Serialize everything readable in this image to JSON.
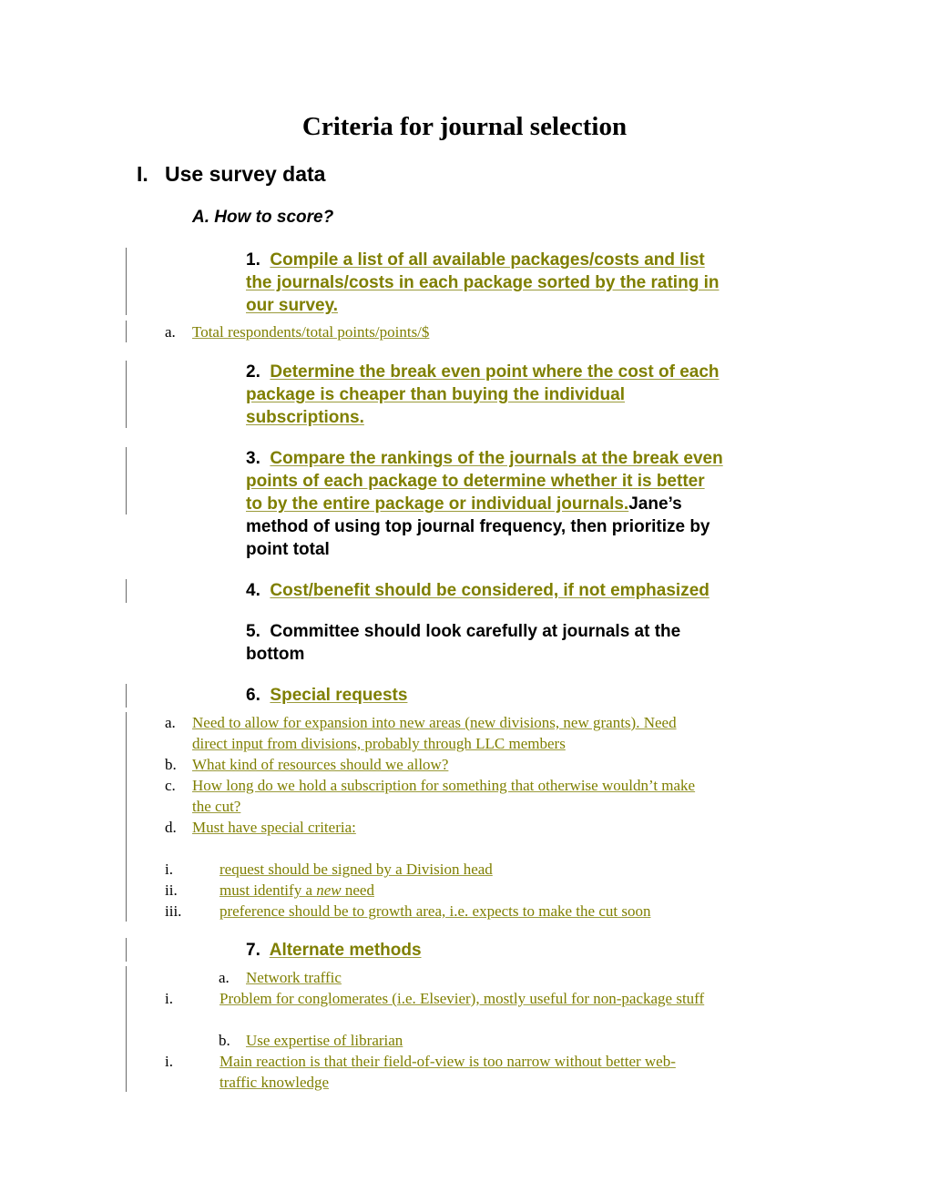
{
  "document": {
    "title": "Criteria for journal selection",
    "section": {
      "number": "I.",
      "label": "Use survey data"
    },
    "subsection": {
      "label": "A. How to score?"
    },
    "colors": {
      "revision_text": "#7f7f00",
      "revision_underline": "#9b9b3c",
      "change_bar": "#6a6a6a",
      "body_text": "#000000"
    },
    "items": [
      {
        "number": "1.",
        "lines": [
          "Compile a list of all available packages/costs and list ",
          "the journals/costs in each package sorted by the rating in ",
          "our survey."
        ],
        "sub": [
          {
            "label": "a.",
            "lines": [
              "Total respondents/total points/points/$"
            ]
          }
        ]
      },
      {
        "number": "2.",
        "lines": [
          "Determine the break even point where the cost of each ",
          "package is cheaper than buying the individual ",
          "subscriptions."
        ]
      },
      {
        "number": "3.",
        "lines": [
          "Compare the rankings of the journals at the break even",
          "points of each package to determine whether it is better ",
          "to by the entire package or individual journals."
        ],
        "trailing": "Jane’s",
        "trailing_lines": [
          "method of using top journal frequency, then prioritize by",
          "point total"
        ]
      },
      {
        "number": "4.",
        "lines": [
          "Cost/benefit should be considered, if not emphasized"
        ]
      },
      {
        "number": "5.",
        "lines": [
          "Committee should look carefully at journals at the",
          "bottom"
        ]
      },
      {
        "number": "6.",
        "lines": [
          "Special requests"
        ],
        "sub": [
          {
            "label": "a.",
            "lines": [
              "Need to allow for expansion into new areas (new divisions, new grants). Need ",
              "direct input from divisions, probably through LLC members"
            ]
          },
          {
            "label": "b.",
            "lines": [
              "What kind of resources should we allow?"
            ]
          },
          {
            "label": "c.",
            "lines": [
              "How long do we hold a subscription for something that otherwise wouldn’t make ",
              "the cut?"
            ]
          },
          {
            "label": "d.",
            "lines": [
              "Must have special criteria:"
            ]
          }
        ],
        "subsub": [
          {
            "label": "i.",
            "text": "request should be signed by a Division head"
          },
          {
            "label": "ii.",
            "text_before": "must identify a ",
            "text_italic": "new",
            "text_after": " need"
          },
          {
            "label": "iii.",
            "text": "preference should be to growth area, i.e. expects to make the cut soon"
          }
        ]
      },
      {
        "number": "7.",
        "lines": [
          "Alternate methods"
        ],
        "methods": [
          {
            "label": "a.",
            "text": "Network traffic",
            "detail": {
              "label": "i.",
              "lines": [
                "Problem for conglomerates (i.e. Elsevier), mostly useful for non-package stuff"
              ]
            }
          },
          {
            "label": "b.",
            "text": "Use expertise of librarian",
            "detail": {
              "label": "i.",
              "lines": [
                "Main reaction is that their field-of-view is too narrow without better web-",
                "traffic knowledge"
              ]
            }
          }
        ]
      }
    ]
  }
}
